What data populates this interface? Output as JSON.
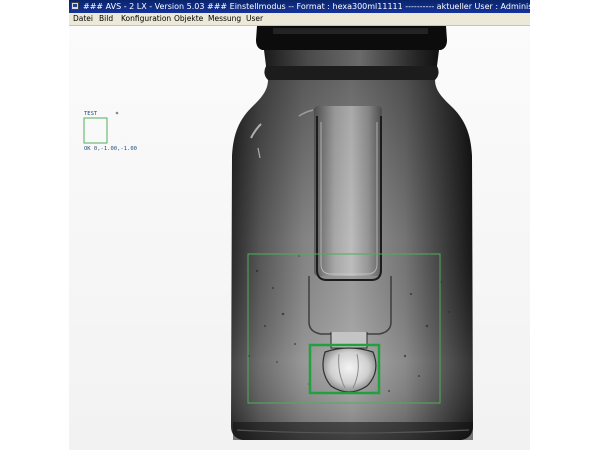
{
  "window": {
    "title": "### AVS - 2 LX - Version 5.03 ### Einstellmodus -- Format : hexa300ml11111 ---------- aktueller User : Administrator"
  },
  "menu": {
    "items": [
      {
        "label": "Datei"
      },
      {
        "label": "Bild"
      },
      {
        "label": "Konfiguration"
      },
      {
        "label": "Objekte"
      },
      {
        "label": "Messung"
      },
      {
        "label": "User"
      }
    ]
  },
  "inspection": {
    "test_tool": {
      "label": "TEST",
      "result": "OK 0,-1.00,-1.00"
    }
  },
  "colors": {
    "title_bar": "#0a246a",
    "roi_outline": "#4fae5c",
    "roi_selected": "#22a040"
  }
}
